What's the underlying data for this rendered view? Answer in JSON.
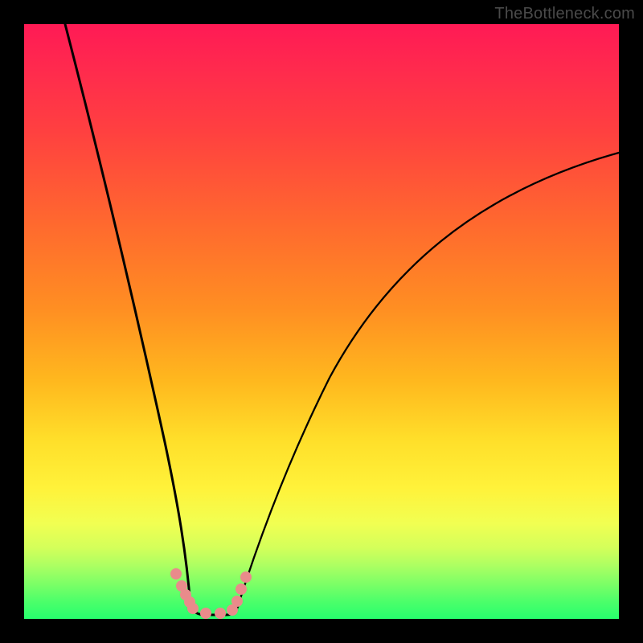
{
  "attribution": "TheBottleneck.com",
  "chart_data": {
    "type": "line",
    "title": "",
    "xlabel": "",
    "ylabel": "",
    "xlim": [
      0,
      100
    ],
    "ylim": [
      0,
      100
    ],
    "grid": false,
    "series": [
      {
        "name": "left-branch",
        "x": [
          7,
          10,
          13,
          16,
          19,
          21,
          23,
          24.5,
          25.5,
          26.5,
          27.2,
          27.7,
          28.0
        ],
        "y": [
          100,
          80,
          62,
          46,
          32,
          22,
          14,
          9,
          6,
          4,
          2.5,
          1.5,
          0.8
        ]
      },
      {
        "name": "right-branch",
        "x": [
          36,
          38,
          41,
          45,
          50,
          56,
          63,
          71,
          80,
          90,
          100
        ],
        "y": [
          0.8,
          4,
          10,
          18,
          28,
          38,
          48,
          57,
          65,
          72,
          78
        ]
      },
      {
        "name": "bottom-flat",
        "x": [
          28,
          30,
          32,
          34,
          36
        ],
        "y": [
          0.8,
          0.5,
          0.5,
          0.5,
          0.8
        ]
      }
    ],
    "markers": {
      "name": "pink-dots",
      "color": "#e98b8b",
      "points_x": [
        25.5,
        26.5,
        27.2,
        27.8,
        28.3,
        30.5,
        33.0,
        35.0,
        35.8,
        36.5,
        37.2
      ],
      "points_y": [
        7.5,
        5.5,
        4.0,
        2.8,
        1.8,
        1.0,
        1.0,
        1.5,
        3.0,
        5.0,
        7.0
      ]
    },
    "background_gradient": {
      "top": "#ff1a55",
      "mid_upper": "#ff8f22",
      "mid_lower": "#fff23a",
      "bottom": "#27ff6d"
    }
  }
}
